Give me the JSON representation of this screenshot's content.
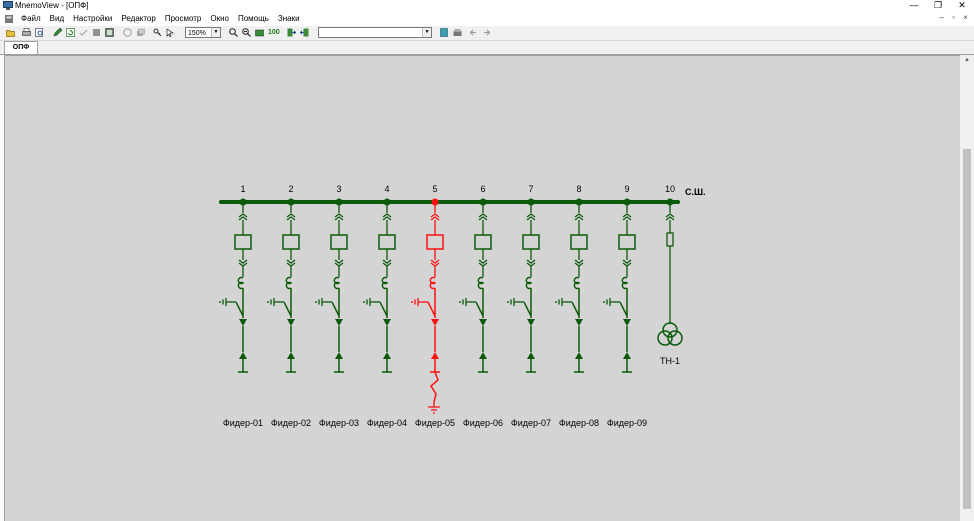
{
  "window": {
    "title": "MnemoView - [ОПФ]",
    "minimize_glyph": "—",
    "maximize_glyph": "❐",
    "close_glyph": "✕"
  },
  "menu": [
    "Файл",
    "Вид",
    "Настройки",
    "Редактор",
    "Просмотр",
    "Окно",
    "Помощь",
    "Знаки"
  ],
  "mdi": {
    "minimize_glyph": "–",
    "restore_glyph": "▫",
    "close_glyph": "×"
  },
  "toolbar": {
    "zoom_value": "150%",
    "scheme_value": "",
    "zoom_100_label": "100"
  },
  "tabs": [
    {
      "label": "ОПФ",
      "active": true
    }
  ],
  "colors": {
    "normal": "#0b5a0b",
    "fault": "#ff1010",
    "canvas": "#d4d4d4"
  },
  "scheme": {
    "bus_label": "С.Ш.",
    "transformer_label": "ТН-1",
    "cells": [
      {
        "num": "1",
        "feeder": "Фидер-01",
        "state": "normal"
      },
      {
        "num": "2",
        "feeder": "Фидер-02",
        "state": "normal"
      },
      {
        "num": "3",
        "feeder": "Фидер-03",
        "state": "normal"
      },
      {
        "num": "4",
        "feeder": "Фидер-04",
        "state": "normal"
      },
      {
        "num": "5",
        "feeder": "Фидер-05",
        "state": "fault"
      },
      {
        "num": "6",
        "feeder": "Фидер-06",
        "state": "normal"
      },
      {
        "num": "7",
        "feeder": "Фидер-07",
        "state": "normal"
      },
      {
        "num": "8",
        "feeder": "Фидер-08",
        "state": "normal"
      },
      {
        "num": "9",
        "feeder": "Фидер-09",
        "state": "normal"
      }
    ],
    "tn_cell_num": "10"
  }
}
